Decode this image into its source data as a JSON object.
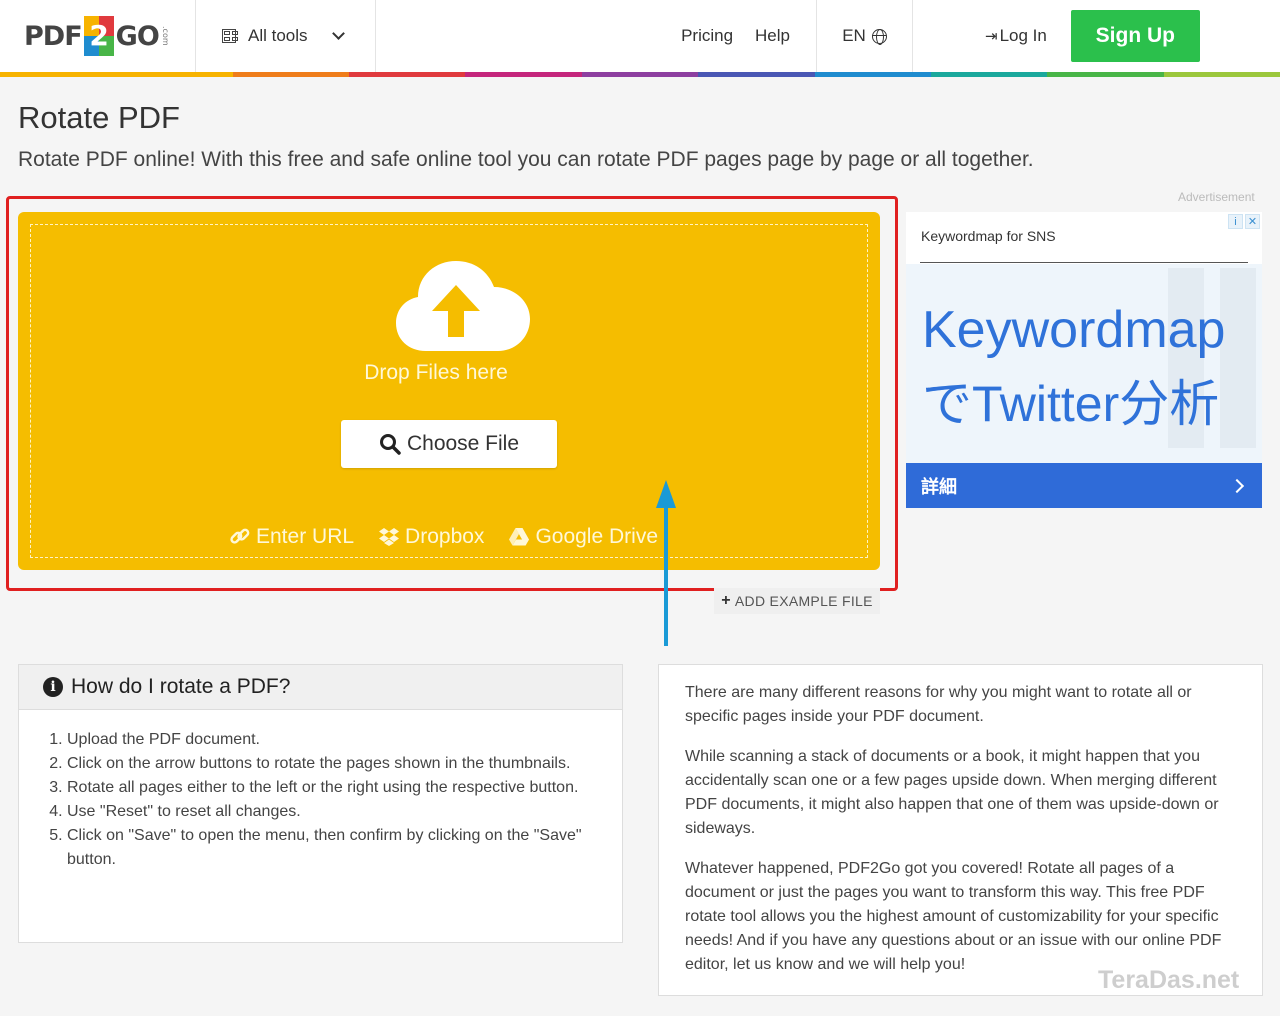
{
  "header": {
    "logo_left": "PDF",
    "logo_num": "2",
    "logo_right": "GO",
    "logo_com": ".com",
    "all_tools": "All tools",
    "pricing": "Pricing",
    "help": "Help",
    "lang": "EN",
    "login": "Log In",
    "signup": "Sign Up"
  },
  "colors": {
    "rainbow": [
      "#f7b300",
      "#f7b300",
      "#ef7d1a",
      "#e03a3e",
      "#c4267c",
      "#8d3fa0",
      "#4a57b4",
      "#1f8ccf",
      "#1aa89c",
      "#48b547",
      "#9bc73c"
    ],
    "upload_bg": "#f5bd00",
    "signup_bg": "#2bc04c",
    "ad_blue": "#2f6bd8"
  },
  "page": {
    "title": "Rotate PDF",
    "subtitle": "Rotate PDF online! With this free and safe online tool you can rotate PDF pages page by page or all together."
  },
  "upload": {
    "drop_label": "Drop Files here",
    "choose_label": "Choose File",
    "enter_url": "Enter URL",
    "dropbox": "Dropbox",
    "google_drive": "Google Drive",
    "add_example": "ADD EXAMPLE FILE"
  },
  "ad": {
    "label": "Advertisement",
    "brand": "Keywordmap for SNS",
    "headline1": "Keywordmap",
    "headline2": "でTwitter分析",
    "cta": "詳細"
  },
  "howto": {
    "title": "How do I rotate a PDF?",
    "steps": [
      "Upload the PDF document.",
      "Click on the arrow buttons to rotate the pages shown in the thumbnails.",
      "Rotate all pages either to the left or the right using the respective button.",
      "Use \"Reset\" to reset all changes.",
      "Click on \"Save\" to open the menu, then confirm by clicking on the \"Save\" button."
    ]
  },
  "reasons": {
    "p1": "There are many different reasons for why you might want to rotate all or specific pages inside your PDF document.",
    "p2": "While scanning a stack of documents or a book, it might happen that you accidentally scan one or a few pages upside down. When merging different PDF documents, it might also happen that one of them was upside-down or sideways.",
    "p3": "Whatever happened, PDF2Go got you covered! Rotate all pages of a document or just the pages you want to transform this way. This free PDF rotate tool allows you the highest amount of customizability for your specific needs! And if you have any questions about or an issue with our online PDF editor, let us know and we will help you!"
  },
  "watermark": "TeraDas.net"
}
